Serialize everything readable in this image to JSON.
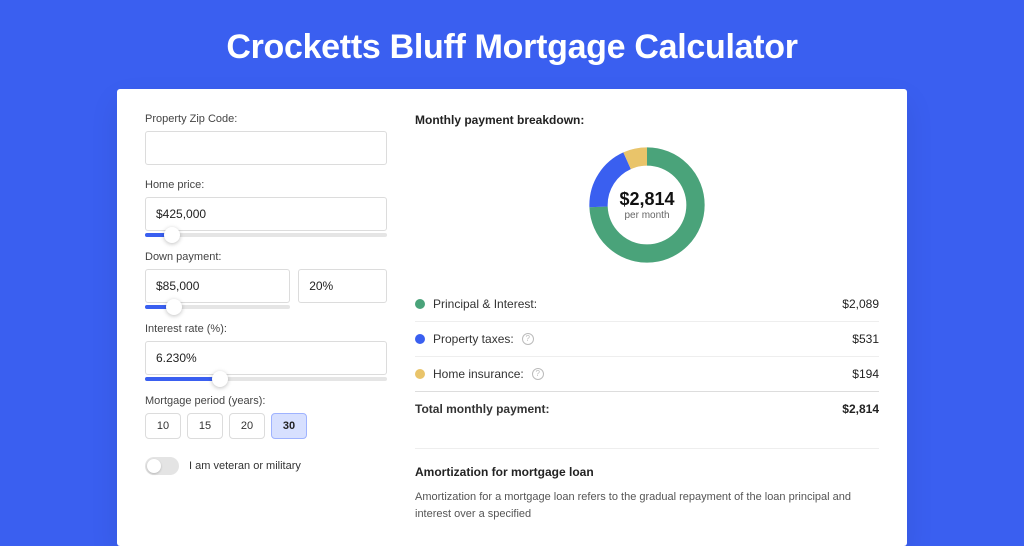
{
  "page": {
    "title": "Crocketts Bluff Mortgage Calculator"
  },
  "form": {
    "zip_label": "Property Zip Code:",
    "zip_value": "",
    "price_label": "Home price:",
    "price_value": "$425,000",
    "price_slider_pct": 11,
    "down_label": "Down payment:",
    "down_amount": "$85,000",
    "down_pct": "20%",
    "down_slider_pct": 20,
    "rate_label": "Interest rate (%):",
    "rate_value": "6.230%",
    "rate_slider_pct": 31,
    "period_label": "Mortgage period (years):",
    "periods": [
      "10",
      "15",
      "20",
      "30"
    ],
    "period_active": 3,
    "veteran_label": "I am veteran or military",
    "veteran_on": false
  },
  "breakdown": {
    "title": "Monthly payment breakdown:",
    "center_value": "$2,814",
    "center_sub": "per month",
    "items": [
      {
        "label": "Principal & Interest:",
        "amount": "$2,089",
        "color": "green",
        "info": false
      },
      {
        "label": "Property taxes:",
        "amount": "$531",
        "color": "blue",
        "info": true
      },
      {
        "label": "Home insurance:",
        "amount": "$194",
        "color": "gold",
        "info": true
      }
    ],
    "total_label": "Total monthly payment:",
    "total_amount": "$2,814"
  },
  "amort": {
    "title": "Amortization for mortgage loan",
    "text": "Amortization for a mortgage loan refers to the gradual repayment of the loan principal and interest over a specified"
  },
  "chart_data": {
    "type": "pie",
    "title": "Monthly payment breakdown",
    "series": [
      {
        "name": "Principal & Interest",
        "value": 2089,
        "color": "#4aa37a"
      },
      {
        "name": "Property taxes",
        "value": 531,
        "color": "#3a5ff0"
      },
      {
        "name": "Home insurance",
        "value": 194,
        "color": "#e9c46a"
      }
    ],
    "total": 2814
  }
}
